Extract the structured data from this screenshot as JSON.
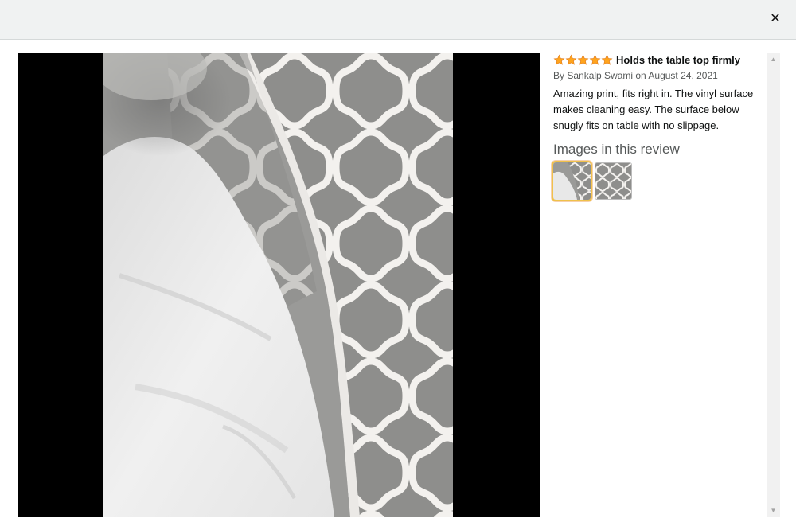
{
  "header": {
    "close_icon": "close-icon",
    "close_glyph": "✕"
  },
  "media": {
    "image_subject": "grey moroccan-trellis table cover folded over white underside"
  },
  "review": {
    "rating": 5,
    "rating_max": 5,
    "star_color": "#ffa41c",
    "title": "Holds the table top firmly",
    "byline": "By Sankalp Swami on August 24, 2021",
    "body": "Amazing print, fits right in. The vinyl surface makes cleaning easy. The surface below snugly fits on table with no slippage.",
    "images_heading": "Images in this review"
  },
  "thumbnails": [
    {
      "name": "thumbnail-1",
      "selected": true
    },
    {
      "name": "thumbnail-2",
      "selected": false
    }
  ],
  "scrollbar": {
    "up_glyph": "▲",
    "down_glyph": "▼"
  }
}
